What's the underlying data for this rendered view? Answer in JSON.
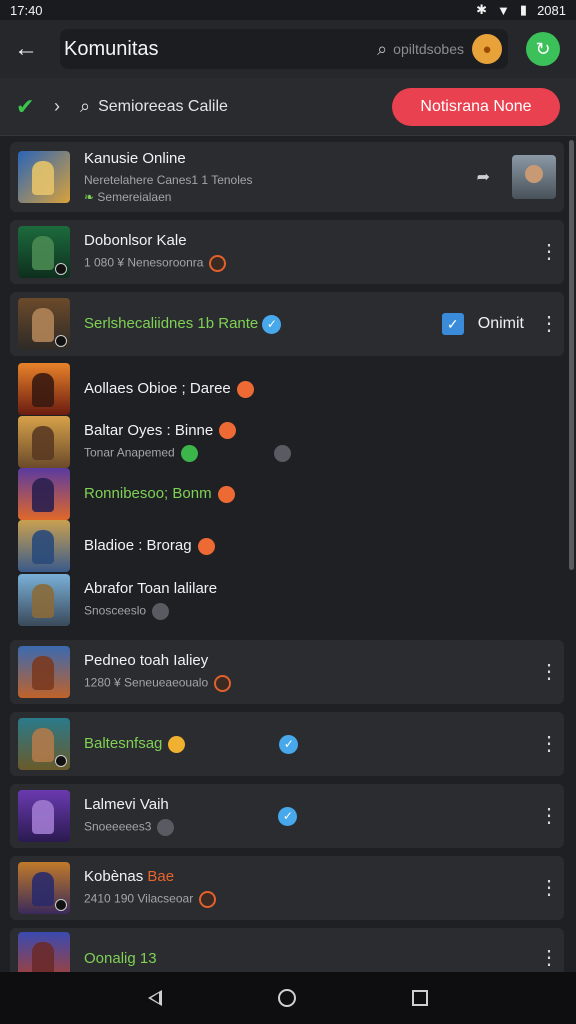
{
  "status": {
    "time": "17:40",
    "right": "2081"
  },
  "header": {
    "title": "Komunitas",
    "search_hint": "opiltdsobes"
  },
  "filter": {
    "label": "Semioreeas Calile",
    "button": "Notisrana None"
  },
  "colors": {
    "accent_red": "#e9414f",
    "accent_green": "#3cc05a",
    "verified_blue": "#48a8ec",
    "green_text": "#7fd155"
  },
  "items": [
    {
      "title": "Kanusie Online",
      "sub1": "Neretelahere Canes1 1 Tenoles",
      "sub2": "Semereialaen",
      "action": "share",
      "icon": "mosaic-game-icon"
    },
    {
      "title": "Dobonlsor Kale",
      "sub1": "1 080 ¥ Nenesoroonra",
      "action": "menu"
    },
    {
      "title": "Serlshecaliidnes 1b Rante",
      "title_green": true,
      "action": "checkbox",
      "checkbox_label": "Onimit"
    },
    {
      "title": "Aollaes Obioe ; Daree"
    },
    {
      "title": "Baltar Oyes : Binne",
      "sub1": "Tonar Anapemed"
    },
    {
      "title": "Ronnibesoo; Bonm",
      "title_green": true
    },
    {
      "title": "Bladioe : Brorag"
    },
    {
      "title": "Abrafor Toan lalilare",
      "sub1": "Snosceeslo"
    },
    {
      "title": "Pedneo toah Ialiey",
      "sub1": "1280 ¥ Seneueaeoualo",
      "action": "menu"
    },
    {
      "title": "Baltesnfsag",
      "title_green": true,
      "action": "menu"
    },
    {
      "title": "Lalmevi Vaih",
      "sub1": "Snoeeeees3",
      "action": "menu"
    },
    {
      "title": "Kobènas",
      "title_suffix": "Bae",
      "sub1": "2410 190 Vilacseoar",
      "action": "menu"
    },
    {
      "title": "Oonalig 13",
      "title_green": true,
      "action": "menu"
    }
  ]
}
